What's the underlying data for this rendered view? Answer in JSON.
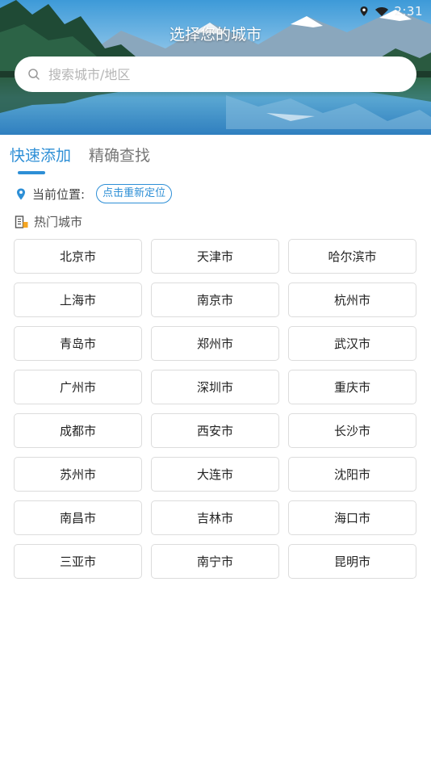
{
  "status_bar": {
    "time": "2:31",
    "icons": [
      "location-icon",
      "wifi-icon"
    ]
  },
  "header": {
    "title": "选择您的城市"
  },
  "search": {
    "placeholder": "搜索城市/地区",
    "value": ""
  },
  "tabs": [
    {
      "label": "快速添加",
      "active": true
    },
    {
      "label": "精确查找",
      "active": false
    }
  ],
  "location": {
    "label": "当前位置:",
    "relocate_label": "点击重新定位"
  },
  "hot_cities": {
    "label": "热门城市",
    "cities": [
      "北京市",
      "天津市",
      "哈尔滨市",
      "上海市",
      "南京市",
      "杭州市",
      "青岛市",
      "郑州市",
      "武汉市",
      "广州市",
      "深圳市",
      "重庆市",
      "成都市",
      "西安市",
      "长沙市",
      "苏州市",
      "大连市",
      "沈阳市",
      "南昌市",
      "吉林市",
      "海口市",
      "三亚市",
      "南宁市",
      "昆明市"
    ]
  },
  "colors": {
    "accent": "#2e8fd6",
    "tab_inactive": "#777777",
    "city_border": "#dcdcdc"
  }
}
